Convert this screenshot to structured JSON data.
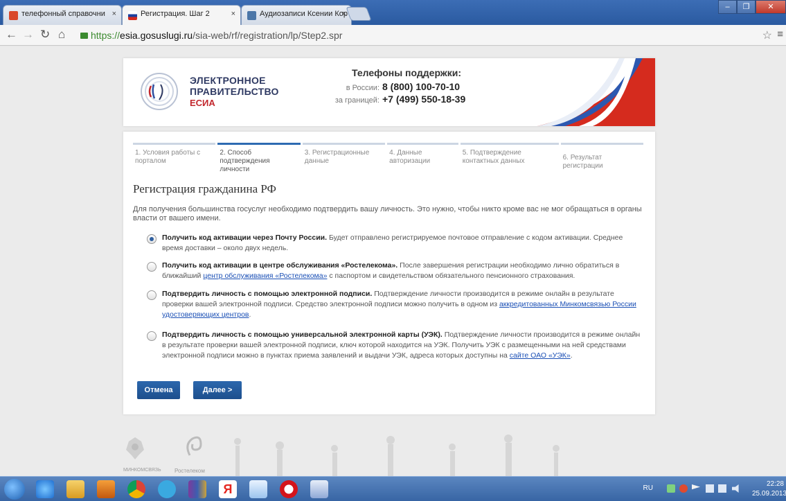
{
  "browser": {
    "tabs": [
      {
        "title": "телефонный справочни",
        "favicon_color": "#d9482b"
      },
      {
        "title": "Регистрация. Шаг 2",
        "favicon_color": "#1a3f9e",
        "active": true
      },
      {
        "title": "Аудиозаписи Ксении Кор",
        "favicon_color": "#4a76a8"
      }
    ],
    "close_glyph": "×",
    "url": {
      "scheme": "https://",
      "host": "esia.gosuslugi.ru",
      "path": "/sia-web/rf/registration/lp/Step2.spr"
    },
    "icons": [
      "back-icon",
      "forward-icon",
      "reload-icon",
      "home-icon",
      "lock-icon",
      "star-icon",
      "menu-icon"
    ],
    "window_buttons": [
      "minimize-icon",
      "maximize-icon",
      "close-icon"
    ]
  },
  "header": {
    "logo": {
      "line1": "ЭЛЕКТРОННОЕ",
      "line2": "ПРАВИТЕЛЬСТВО",
      "line3": "ЕСИА"
    },
    "support": {
      "title": "Телефоны поддержки:",
      "rows": [
        {
          "label": "в России:",
          "number": "8 (800) 100-70-10"
        },
        {
          "label": "за границей:",
          "number": "+7 (499) 550-18-39"
        }
      ]
    }
  },
  "steps": [
    {
      "label": "1. Условия работы с порталом"
    },
    {
      "label": "2. Способ подтверждения личности",
      "active": true
    },
    {
      "label": "3. Регистрационные данные"
    },
    {
      "label": "4. Данные авторизации"
    },
    {
      "label": "5. Подтверждение контактных данных"
    },
    {
      "label": "6. Результат регистрации"
    }
  ],
  "form": {
    "title": "Регистрация гражданина РФ",
    "intro": "Для получения большинства госуслуг необходимо подтвердить вашу личность. Это нужно, чтобы никто кроме вас не мог обращаться в органы власти от вашего имени.",
    "options": [
      {
        "checked": true,
        "bold": "Получить код активации через Почту России.",
        "text": " Будет отправлено регистрируемое почтовое отправление с кодом активации. Среднее время доставки – около двух недель.",
        "link": "",
        "after_link": ""
      },
      {
        "checked": false,
        "bold": "Получить код активации в центре обслуживания «Ростелекома».",
        "text": " После завершения регистрации необходимо лично обратиться в ближайший ",
        "link": "центр обслуживания «Ростелекома»",
        "after_link": " с паспортом и свидетельством обязательного пенсионного страхования."
      },
      {
        "checked": false,
        "bold": "Подтвердить личность с помощью электронной подписи.",
        "text": " Подтверждение личности производится в режиме онлайн в результате проверки вашей электронной подписи. Средство электронной подписи можно получить в одном из ",
        "link": "аккредитованных Минкомсвязью России удостоверяющих центров",
        "after_link": "."
      },
      {
        "checked": false,
        "bold": "Подтвердить личность с помощью универсальной электронной карты (УЭК).",
        "text": " Подтверждение личности производится в режиме онлайн в результате проверки вашей электронной подписи, ключ которой находится на УЭК. Получить УЭК с размещенными на ней средствами электронной подписи можно в пунктах приема заявлений и выдачи УЭК, адреса которых доступны на ",
        "link": "сайте ОАО «УЭК»",
        "after_link": "."
      }
    ],
    "buttons": {
      "cancel": "Отмена",
      "next": "Далее >"
    }
  },
  "footer": {
    "logo1": "МИНКОМСВЯЗЬ",
    "logo2": "Ростелеком"
  },
  "taskbar": {
    "icons": [
      "windows-start-icon",
      "ie-icon",
      "explorer-icon",
      "media-icon",
      "chrome-icon",
      "skype-icon",
      "winrar-icon",
      "yandex-icon",
      "mail-icon",
      "opera-icon",
      "word-icon"
    ],
    "lang": "RU",
    "time": "22:28",
    "date": "25.09.2013"
  }
}
